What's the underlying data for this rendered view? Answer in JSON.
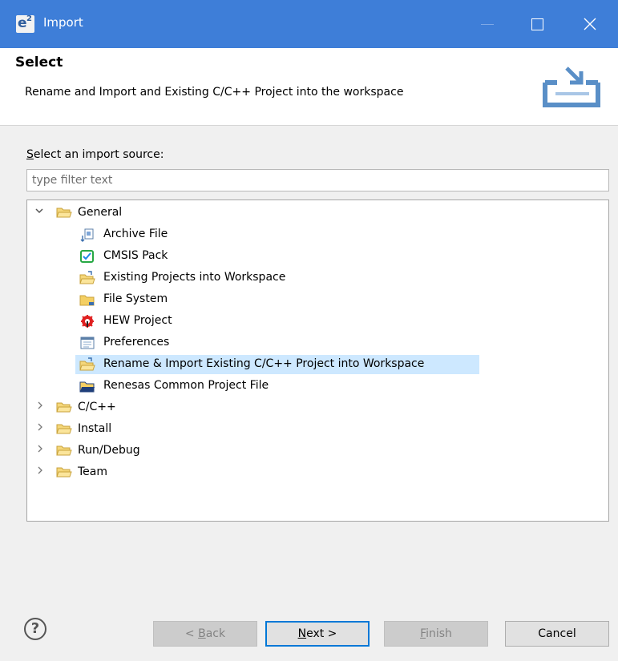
{
  "window": {
    "title": "Import",
    "logo_letter": "e",
    "logo_superscript": "2"
  },
  "header": {
    "title": "Select",
    "description": "Rename and Import and Existing C/C++ Project into the workspace"
  },
  "source": {
    "label_accel": "S",
    "label_rest": "elect an import source:",
    "filter_placeholder": "type filter text"
  },
  "tree": {
    "general": {
      "label": "General",
      "expanded": true
    },
    "children": [
      {
        "label": "Archive File",
        "icon": "archive-file-icon"
      },
      {
        "label": "CMSIS Pack",
        "icon": "cmsis-pack-icon"
      },
      {
        "label": "Existing Projects into Workspace",
        "icon": "existing-projects-icon"
      },
      {
        "label": "File System",
        "icon": "file-system-folder-icon"
      },
      {
        "label": "HEW Project",
        "icon": "hew-project-icon"
      },
      {
        "label": "Preferences",
        "icon": "preferences-icon"
      },
      {
        "label": "Rename & Import Existing C/C++ Project into Workspace",
        "icon": "rename-import-icon",
        "selected": true
      },
      {
        "label": "Renesas Common Project File",
        "icon": "renesas-project-file-icon"
      }
    ],
    "collapsed": [
      {
        "label": "C/C++"
      },
      {
        "label": "Install"
      },
      {
        "label": "Run/Debug"
      },
      {
        "label": "Team"
      }
    ]
  },
  "buttons": {
    "help": "?",
    "back_prefix": "< ",
    "back_accel": "B",
    "back_rest": "ack",
    "next_accel": "N",
    "next_rest": "ext >",
    "finish_accel": "F",
    "finish_rest": "inish",
    "cancel": "Cancel"
  },
  "colors": {
    "titlebar": "#3e7ed8",
    "selection": "#cde8ff",
    "default_button_border": "#0078d7"
  }
}
